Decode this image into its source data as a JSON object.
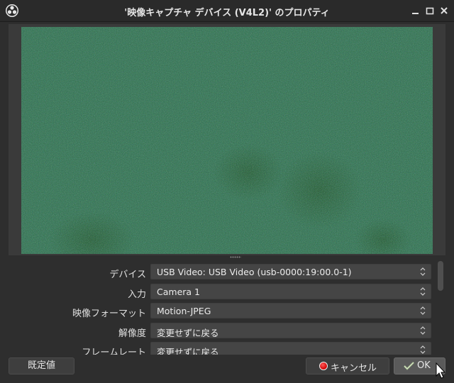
{
  "window": {
    "title": "'映像キャプチャ デバイス (V4L2)' のプロパティ",
    "controls": [
      "minimize-icon",
      "maximize-icon",
      "close-icon"
    ]
  },
  "preview": {
    "dominant_color": "#2f6c4a"
  },
  "properties": [
    {
      "key": "device",
      "label": "デバイス",
      "value": "USB Video: USB Video (usb-0000:19:00.0-1)"
    },
    {
      "key": "input",
      "label": "入力",
      "value": "Camera 1"
    },
    {
      "key": "format",
      "label": "映像フォーマット",
      "value": "Motion-JPEG"
    },
    {
      "key": "resolution",
      "label": "解像度",
      "value": "変更せずに戻る"
    },
    {
      "key": "framerate",
      "label": "フレームレート",
      "value": "変更せずに戻る"
    }
  ],
  "buttons": {
    "defaults": "既定値",
    "cancel": "キャンセル",
    "ok": "OK"
  },
  "colors": {
    "cancel_icon": "#e00000",
    "ok_highlight": "#5a5a5a"
  }
}
